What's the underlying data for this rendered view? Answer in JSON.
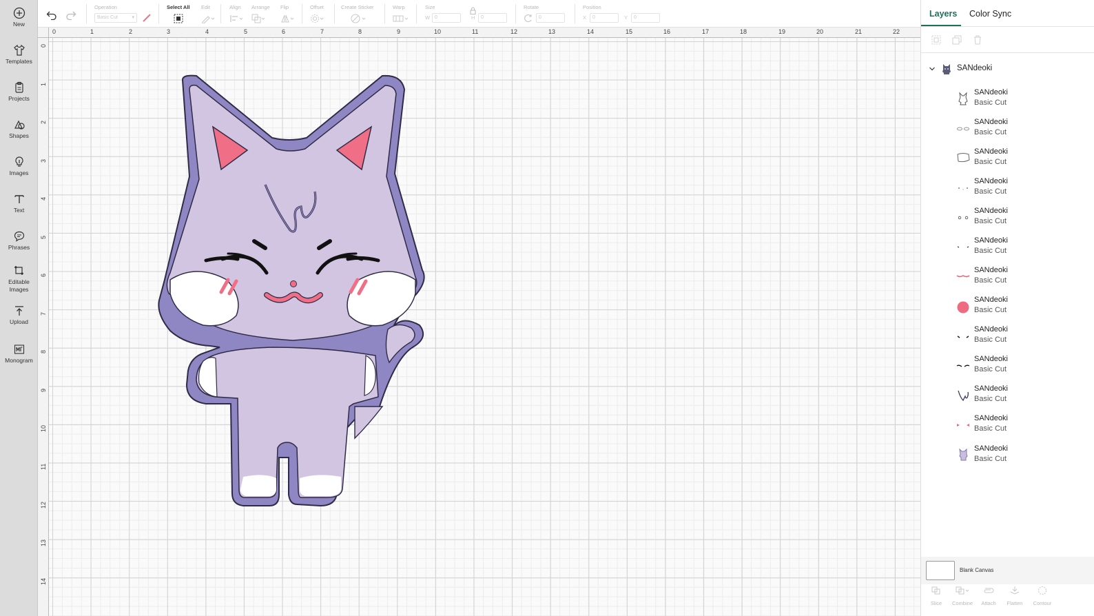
{
  "sidebar": {
    "items": [
      {
        "label": "New",
        "icon": "plus-circle-icon"
      },
      {
        "label": "Templates",
        "icon": "shirt-icon"
      },
      {
        "label": "Projects",
        "icon": "clipboard-icon"
      },
      {
        "label": "Shapes",
        "icon": "shapes-icon"
      },
      {
        "label": "Images",
        "icon": "lightbulb-icon"
      },
      {
        "label": "Text",
        "icon": "text-icon"
      },
      {
        "label": "Phrases",
        "icon": "speech-bubble-icon"
      },
      {
        "label": "Editable Images",
        "icon": "editable-image-icon"
      },
      {
        "label": "Upload",
        "icon": "upload-icon"
      },
      {
        "label": "Monogram",
        "icon": "monogram-icon"
      }
    ]
  },
  "toolbar": {
    "operation_label": "Operation",
    "operation_value": "Basic Cut",
    "select_all_label": "Select All",
    "edit_label": "Edit",
    "align_label": "Align",
    "arrange_label": "Arrange",
    "flip_label": "Flip",
    "offset_label": "Offset",
    "create_sticker_label": "Create Sticker",
    "warp_label": "Warp",
    "size_label": "Size",
    "size_w_label": "W",
    "size_w_value": "0",
    "size_h_label": "H",
    "size_h_value": "0",
    "rotate_label": "Rotate",
    "rotate_value": "0",
    "position_label": "Position",
    "position_x_label": "X",
    "position_x_value": "0",
    "position_y_label": "Y",
    "position_y_value": "0"
  },
  "canvas": {
    "ruler_top": [
      "0",
      "1",
      "2",
      "3",
      "4",
      "5",
      "6",
      "7",
      "8",
      "9",
      "10",
      "11",
      "12",
      "13",
      "14",
      "15",
      "16",
      "17",
      "18",
      "19",
      "20",
      "21",
      "22"
    ],
    "ruler_left": [
      "0",
      "1",
      "2",
      "3",
      "4",
      "5",
      "6",
      "7",
      "8",
      "9",
      "10",
      "11",
      "12",
      "13",
      "14"
    ],
    "colors": {
      "outline": "#8f86c4",
      "body": "#d2c5e1",
      "ear": "#f06f86",
      "mouth": "#f06f86",
      "cheek": "#ffffff",
      "ink": "#111111"
    }
  },
  "panel": {
    "tabs": [
      "Layers",
      "Color Sync"
    ],
    "group_name": "SANdeoki",
    "layers": [
      {
        "name": "SANdeoki",
        "operation": "Basic Cut",
        "thumb": "outline-thumb"
      },
      {
        "name": "SANdeoki",
        "operation": "Basic Cut",
        "thumb": "whites-thumb"
      },
      {
        "name": "SANdeoki",
        "operation": "Basic Cut",
        "thumb": "face-shape-thumb"
      },
      {
        "name": "SANdeoki",
        "operation": "Basic Cut",
        "thumb": "dots-thumb"
      },
      {
        "name": "SANdeoki",
        "operation": "Basic Cut",
        "thumb": "eye-curves-thumb"
      },
      {
        "name": "SANdeoki",
        "operation": "Basic Cut",
        "thumb": "brows-thumb"
      },
      {
        "name": "SANdeoki",
        "operation": "Basic Cut",
        "thumb": "mouth-thumb"
      },
      {
        "name": "SANdeoki",
        "operation": "Basic Cut",
        "thumb": "pink-circle-thumb"
      },
      {
        "name": "SANdeoki",
        "operation": "Basic Cut",
        "thumb": "lashes-thumb"
      },
      {
        "name": "SANdeoki",
        "operation": "Basic Cut",
        "thumb": "eyes-thumb"
      },
      {
        "name": "SANdeoki",
        "operation": "Basic Cut",
        "thumb": "hair-thumb"
      },
      {
        "name": "SANdeoki",
        "operation": "Basic Cut",
        "thumb": "ears-thumb"
      },
      {
        "name": "SANdeoki",
        "operation": "Basic Cut",
        "thumb": "cat-thumb"
      }
    ],
    "blank_canvas_label": "Blank Canvas",
    "bottom_tools": [
      {
        "label": "Slice",
        "icon": "slice-icon"
      },
      {
        "label": "Combine",
        "icon": "combine-icon"
      },
      {
        "label": "Attach",
        "icon": "attach-icon"
      },
      {
        "label": "Flatten",
        "icon": "flatten-icon"
      },
      {
        "label": "Contour",
        "icon": "contour-icon"
      }
    ]
  }
}
